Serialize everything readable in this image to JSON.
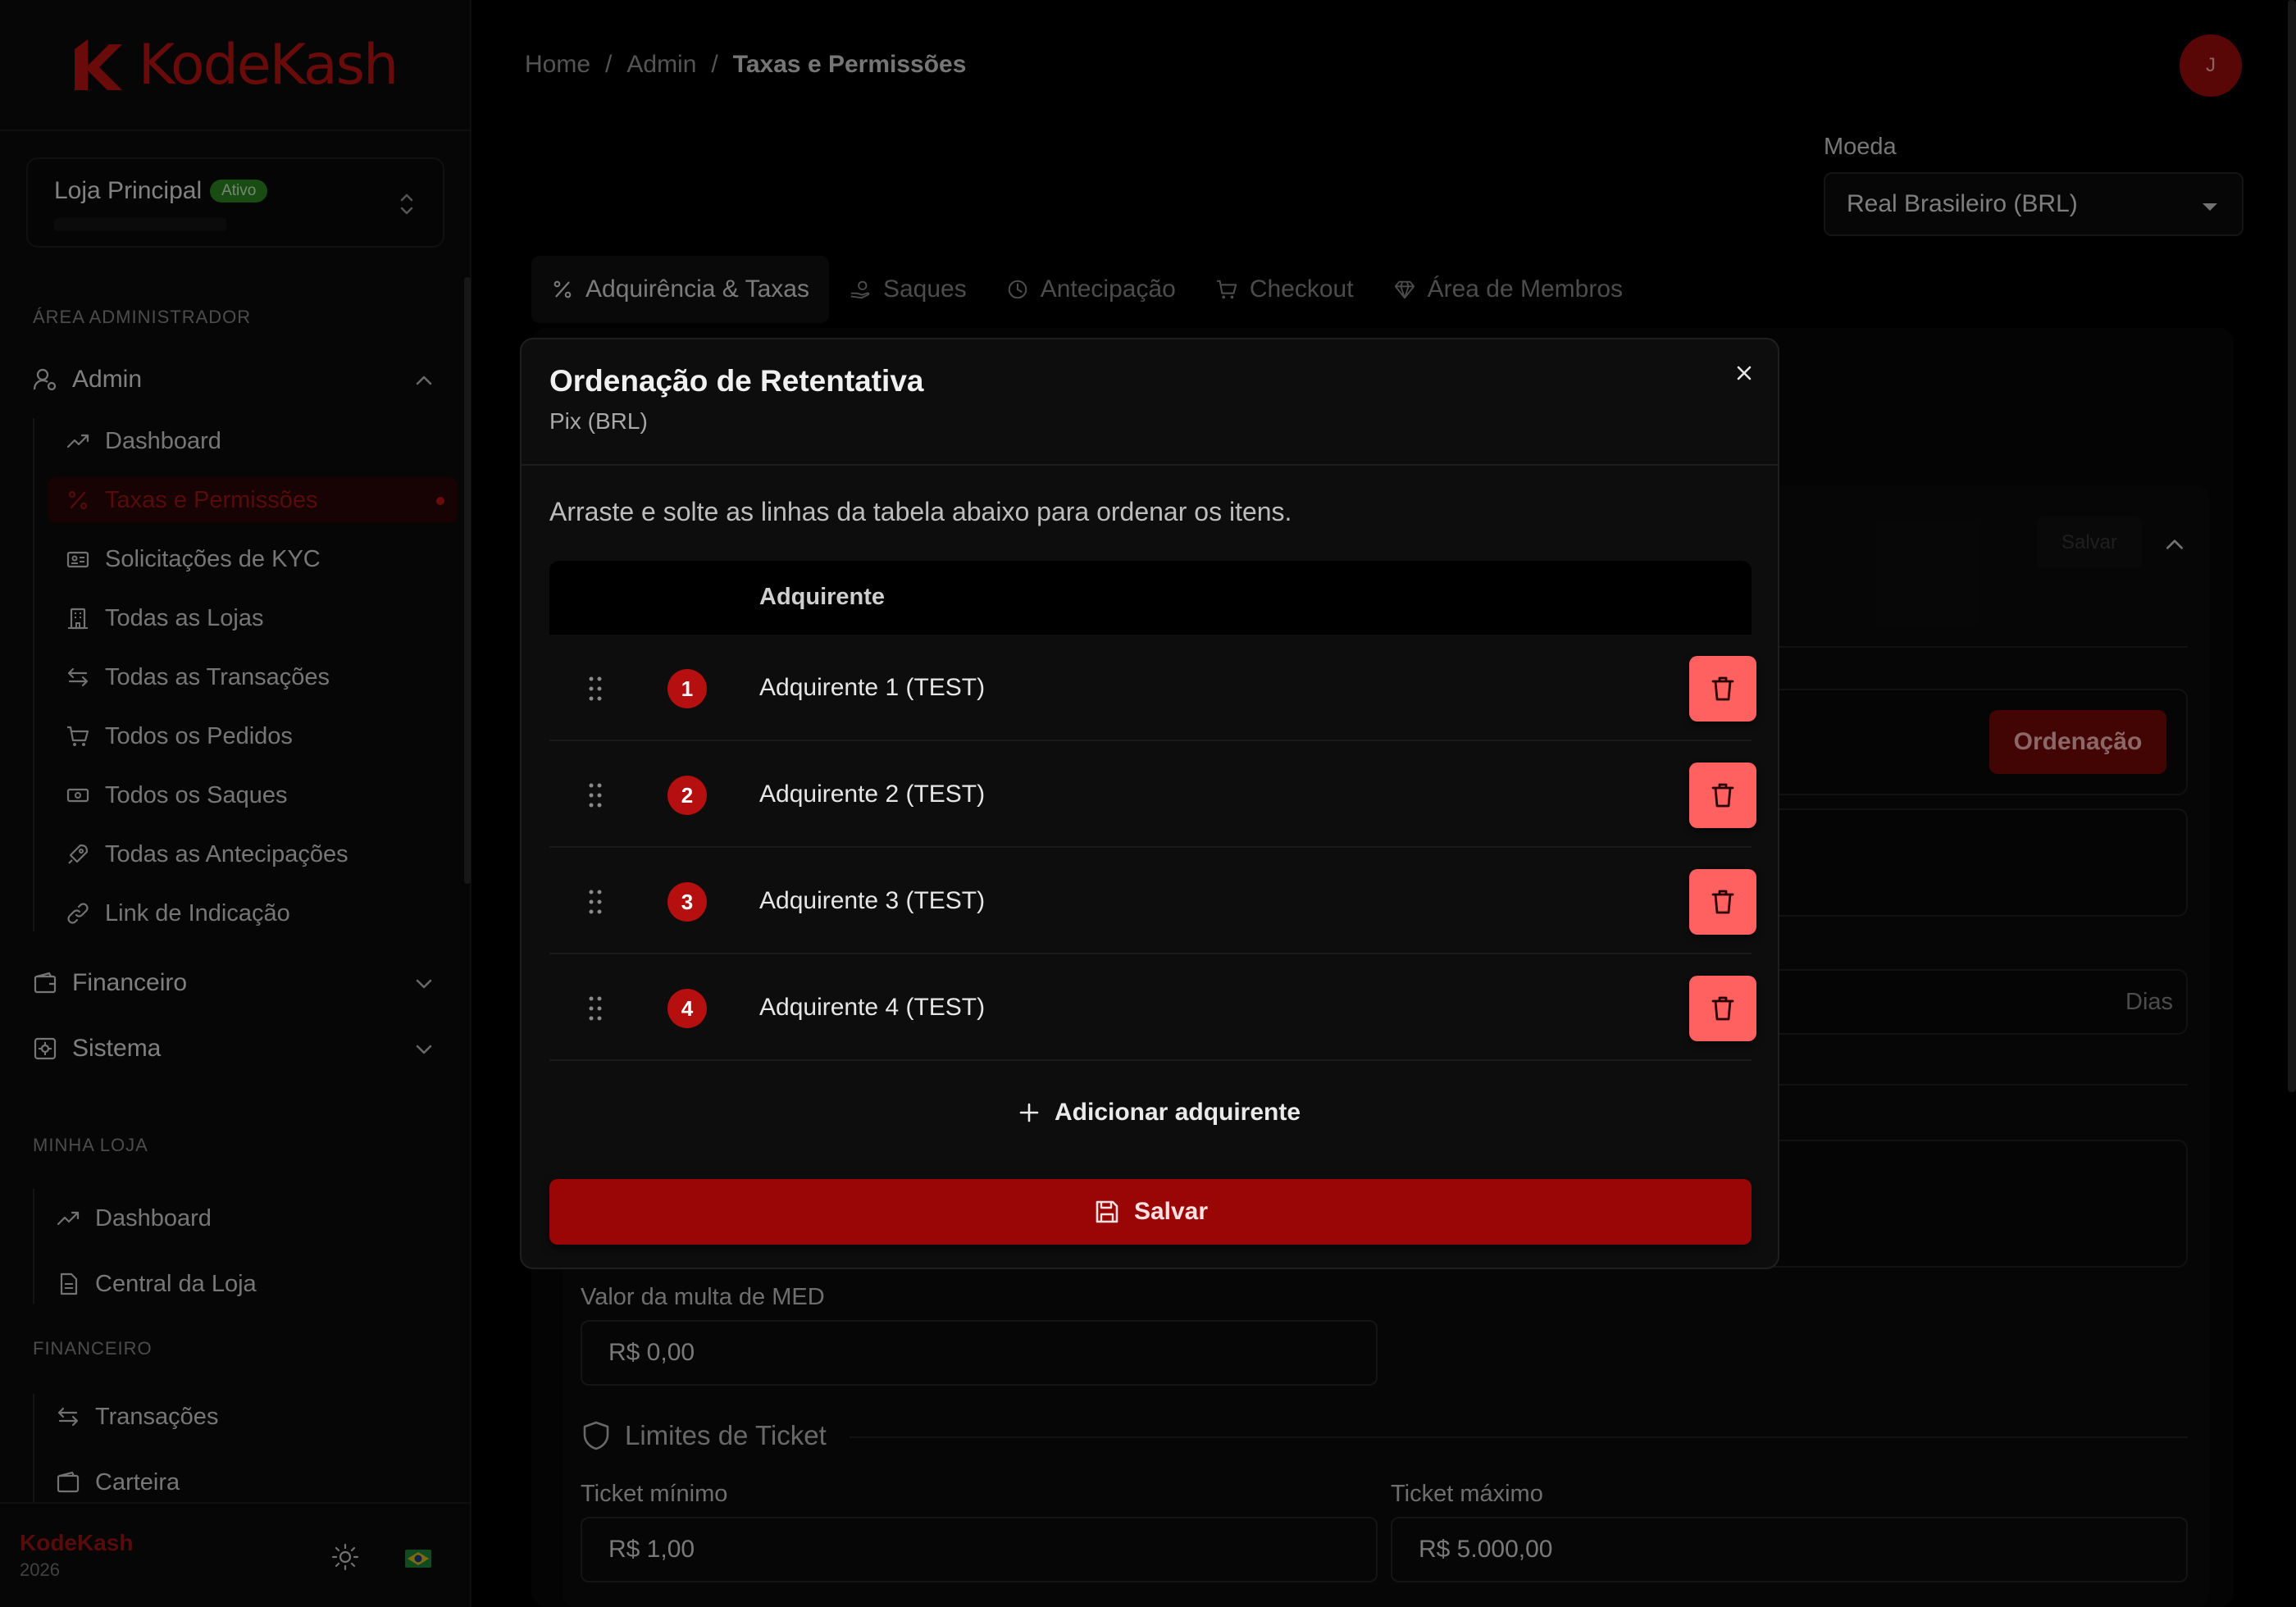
{
  "brand": {
    "name": "KodeKash",
    "year": "2026",
    "color": "#c11414"
  },
  "store": {
    "name": "Loja Principal",
    "status": "Ativo"
  },
  "sidebar": {
    "admin_section": "ÁREA ADMINISTRADOR",
    "admin_group": "Admin",
    "admin_items": [
      {
        "label": "Dashboard",
        "icon": "trending-up-icon"
      },
      {
        "label": "Taxas e Permissões",
        "icon": "percent-icon",
        "active": true
      },
      {
        "label": "Solicitações de KYC",
        "icon": "id-card-icon"
      },
      {
        "label": "Todas as Lojas",
        "icon": "building-icon"
      },
      {
        "label": "Todas as Transações",
        "icon": "arrows-swap-icon"
      },
      {
        "label": "Todos os Pedidos",
        "icon": "cart-icon"
      },
      {
        "label": "Todos os Saques",
        "icon": "banknote-icon"
      },
      {
        "label": "Todas as Antecipações",
        "icon": "rocket-icon"
      },
      {
        "label": "Link de Indicação",
        "icon": "link-icon"
      }
    ],
    "financeiro_group": "Financeiro",
    "sistema_group": "Sistema",
    "store_section": "MINHA LOJA",
    "store_items": [
      {
        "label": "Dashboard",
        "icon": "trending-up-icon"
      },
      {
        "label": "Central da Loja",
        "icon": "document-icon"
      }
    ],
    "fin_section": "FINANCEIRO",
    "fin_items": [
      {
        "label": "Transações",
        "icon": "arrows-swap-icon"
      },
      {
        "label": "Carteira",
        "icon": "wallet-icon"
      }
    ]
  },
  "header": {
    "breadcrumb": [
      "Home",
      "Admin",
      "Taxas e Permissões"
    ],
    "separator": "/",
    "avatar_initial": "J"
  },
  "currency": {
    "label": "Moeda",
    "value": "Real Brasileiro (BRL)"
  },
  "tabs": [
    {
      "label": "Adquirência & Taxas",
      "icon": "percent-icon",
      "active": true
    },
    {
      "label": "Saques",
      "icon": "hand-coins-icon"
    },
    {
      "label": "Antecipação",
      "icon": "clock-icon"
    },
    {
      "label": "Checkout",
      "icon": "cart-icon"
    },
    {
      "label": "Área de Membros",
      "icon": "gem-icon"
    }
  ],
  "background": {
    "save_label": "Salvar",
    "order_button": "Ordenação",
    "days_suffix": "Dias",
    "med_fine": {
      "label": "Valor da multa de MED",
      "value": "R$ 0,00"
    },
    "limits_title": "Limites de Ticket",
    "ticket_min": {
      "label": "Ticket mínimo",
      "value": "R$ 1,00"
    },
    "ticket_max": {
      "label": "Ticket máximo",
      "value": "R$ 5.000,00"
    }
  },
  "modal": {
    "title": "Ordenação de Retentativa",
    "subtitle": "Pix (BRL)",
    "description": "Arraste e solte as linhas da tabela abaixo para ordenar os itens.",
    "column_header": "Adquirente",
    "rows": [
      {
        "order": "1",
        "name": "Adquirente 1 (TEST)"
      },
      {
        "order": "2",
        "name": "Adquirente 2 (TEST)"
      },
      {
        "order": "3",
        "name": "Adquirente 3 (TEST)"
      },
      {
        "order": "4",
        "name": "Adquirente 4 (TEST)"
      }
    ],
    "add_label": "Adicionar adquirente",
    "save_label": "Salvar"
  }
}
